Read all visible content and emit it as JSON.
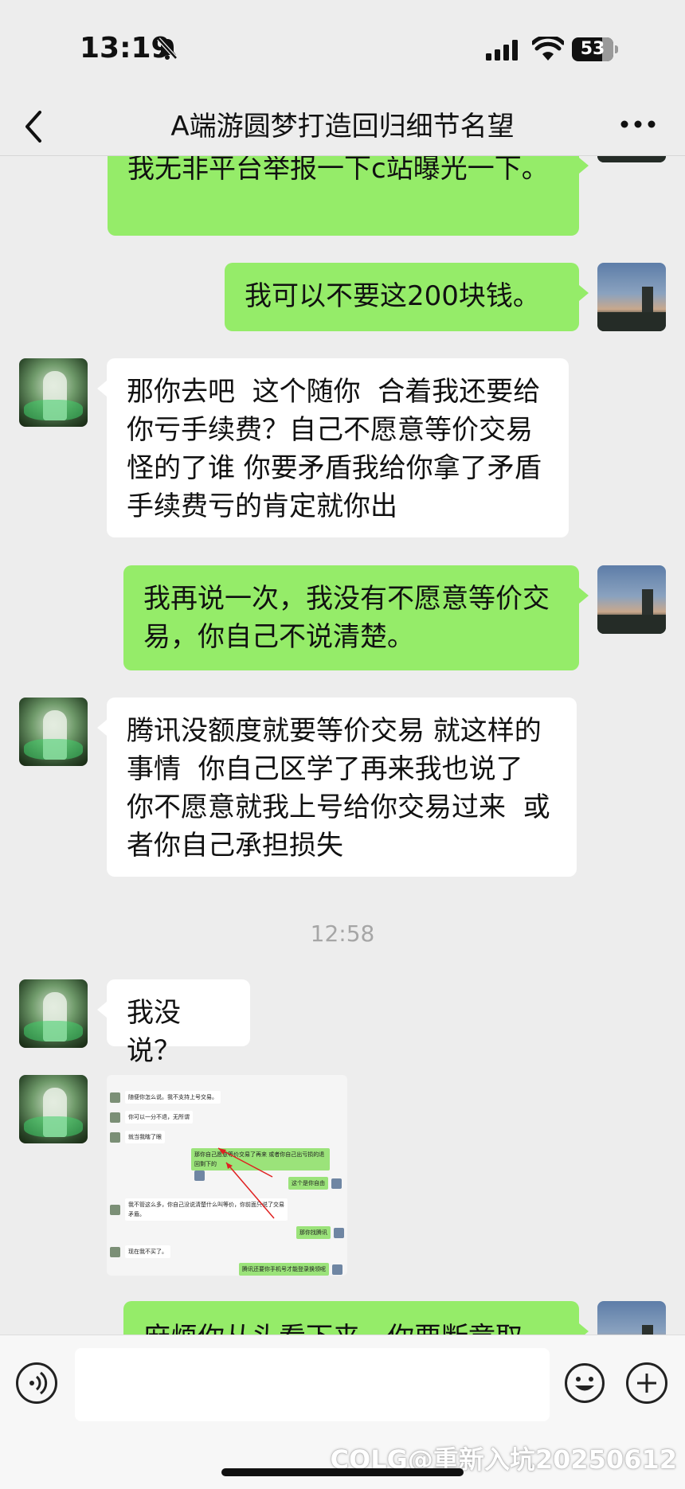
{
  "status": {
    "time": "13:19",
    "battery": "53"
  },
  "nav": {
    "title": "A端游圆梦打造回归细节名望"
  },
  "messages": [
    {
      "side": "out",
      "text": "我无非平台举报一下c站曝光一下。"
    },
    {
      "side": "out",
      "text": "我可以不要这200块钱。"
    },
    {
      "side": "in",
      "text": "那你去吧  这个随你  合着我还要给你亏手续费？自己不愿意等价交易怪的了谁 你要矛盾我给你拿了矛盾 手续费亏的肯定就你出"
    },
    {
      "side": "out",
      "text": "我再说一次，我没有不愿意等价交易，你自己不说清楚。"
    },
    {
      "side": "in",
      "text": "腾讯没额度就要等价交易 就这样的事情  你自己区学了再来我也说了  你不愿意就我上号给你交易过来  或者你自己承担损失"
    },
    {
      "side": "in",
      "text": "我没说？"
    },
    {
      "side": "out",
      "text": "麻烦你从头看下来，你要断章取"
    }
  ],
  "timestamp": "12:58",
  "embedded_screenshot": {
    "rows": [
      {
        "side": "left",
        "text": "随便你怎么说。我不支持上号交易。"
      },
      {
        "side": "left",
        "text": "你可以一分不退，无所谓"
      },
      {
        "side": "left",
        "text": "就当我瞎了眼"
      },
      {
        "side": "right",
        "text": "那你自己愿意等价交易了再来 或者你自己出亏损的退回剩下的"
      },
      {
        "side": "right",
        "text": "这个是你自由"
      },
      {
        "side": "left",
        "text": "我不管这么多，你自己没说清楚什么叫等价，你前面只说了交易矛盾。"
      },
      {
        "side": "right",
        "text": "那你找腾讯"
      },
      {
        "side": "left",
        "text": "现在我不买了。"
      },
      {
        "side": "right",
        "text": "腾讯还要你手机号才能登录换领呢"
      }
    ],
    "annotation_color": "#e02020"
  },
  "input": {
    "placeholder": ""
  },
  "watermark": "COLG@重新入坑20250612"
}
